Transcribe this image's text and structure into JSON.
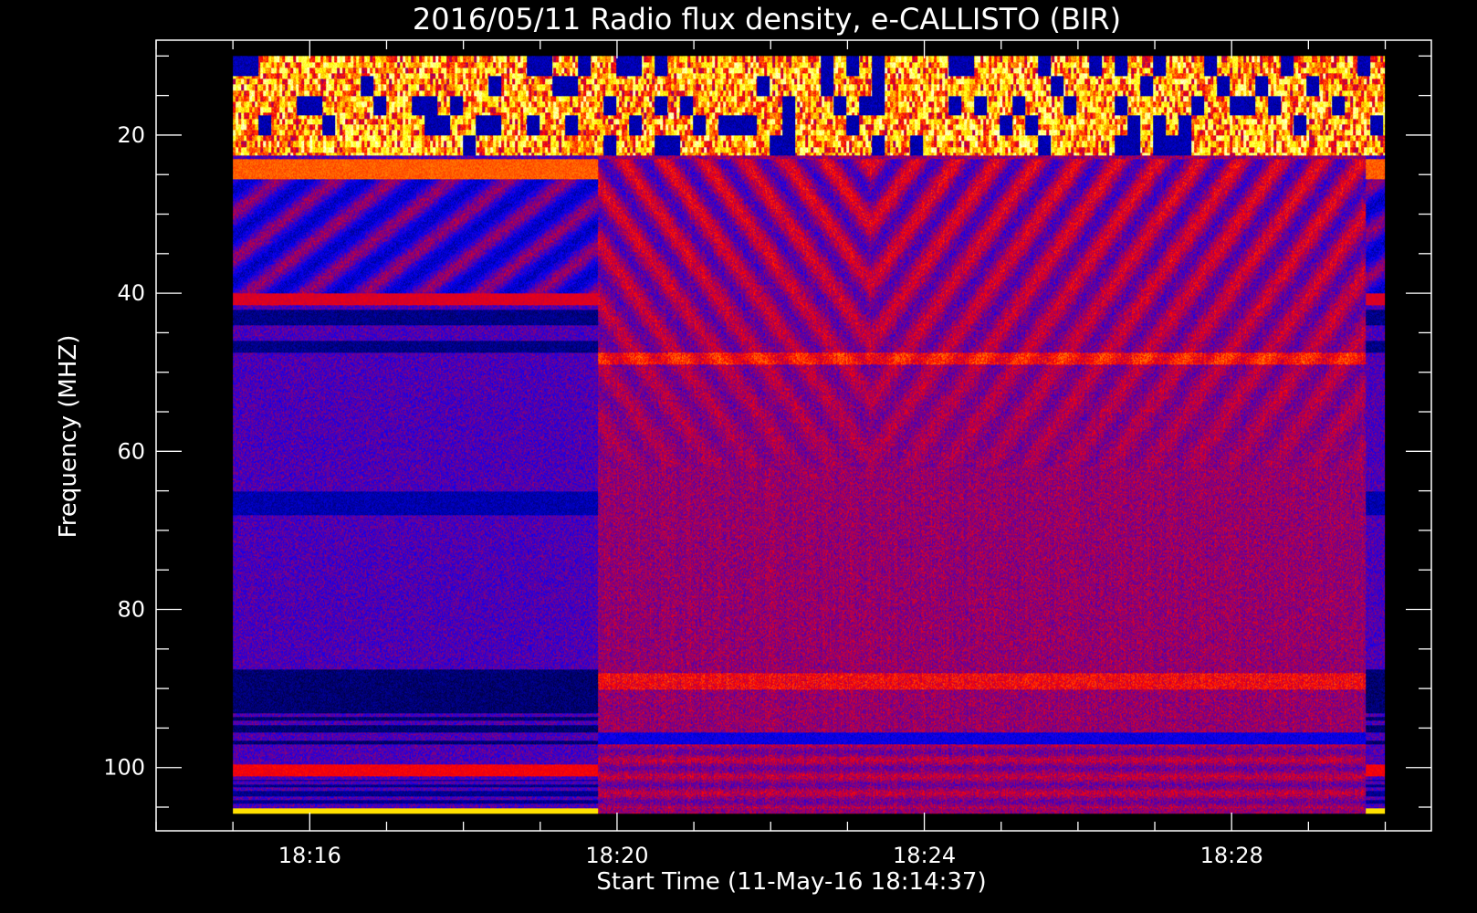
{
  "chart_data": {
    "type": "heatmap",
    "title": "2016/05/11  Radio flux density, e-CALLISTO (BIR)",
    "xlabel": "Start Time (11-May-16 18:14:37)",
    "ylabel": "Frequency (MHZ)",
    "ylim": [
      108.0,
      8.0
    ],
    "xlim_minutes": [
      1094.0,
      1110.6
    ],
    "data_extent": {
      "time_start": "18:15:00",
      "time_end": "18:30:00",
      "freq_top_mhz": 10.0,
      "freq_bottom_mhz": 105.8
    },
    "x_ticks": [
      {
        "minute": 1096,
        "label": "18:16"
      },
      {
        "minute": 1100,
        "label": "18:20"
      },
      {
        "minute": 1104,
        "label": "18:24"
      },
      {
        "minute": 1108,
        "label": "18:28"
      }
    ],
    "x_minor_step_min": 1,
    "y_ticks": [
      {
        "value": 20,
        "label": "20"
      },
      {
        "value": 40,
        "label": "40"
      },
      {
        "value": 60,
        "label": "60"
      },
      {
        "value": 80,
        "label": "80"
      },
      {
        "value": 100,
        "label": "100"
      }
    ],
    "y_minor_step_mhz": 5,
    "colormap": [
      "#000000",
      "#0000ff",
      "#ff0000",
      "#ffff00",
      "#ffffff"
    ],
    "segments": [
      {
        "time_start": "18:15:00",
        "time_end": "18:19:45",
        "label_mode": "dark background"
      },
      {
        "time_start": "18:19:45",
        "time_end": "18:29:45",
        "label_mode": "diffuse background"
      },
      {
        "time_start": "18:29:45",
        "time_end": "18:30:00",
        "label_mode": "dark background"
      }
    ],
    "grid": false,
    "legend": "none"
  }
}
